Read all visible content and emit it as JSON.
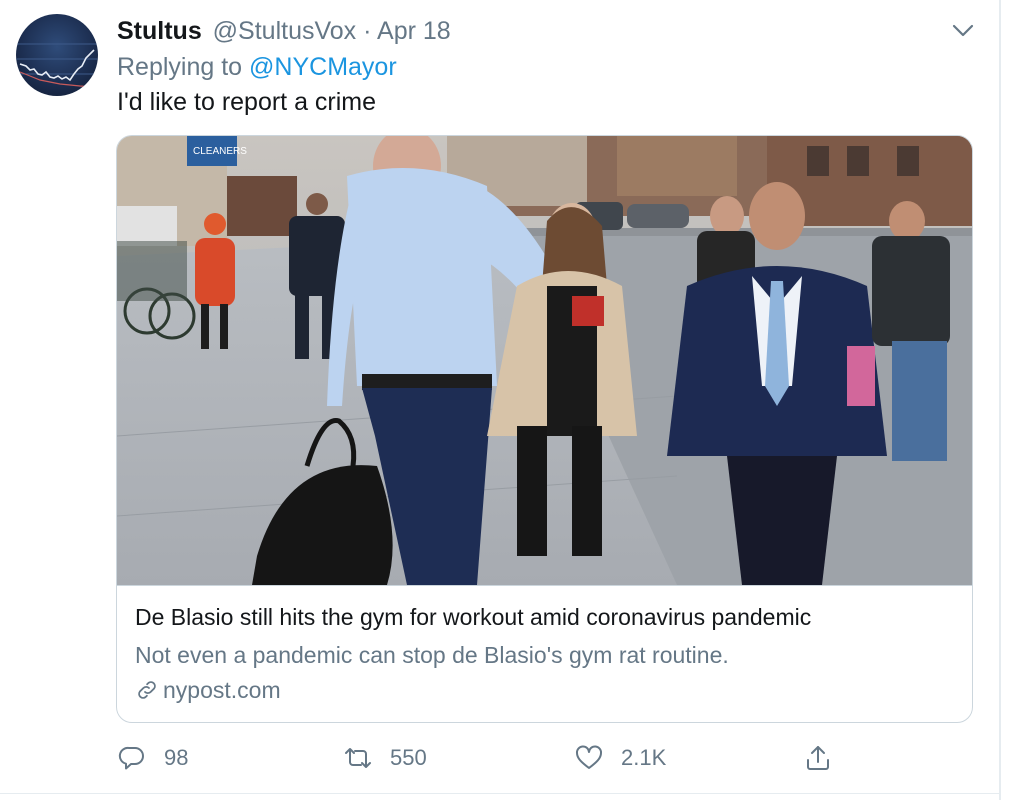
{
  "tweet": {
    "display_name": "Stultus",
    "handle": "@StultusVox",
    "separator": "·",
    "date": "Apr 18",
    "reply_prefix": "Replying to",
    "reply_to": "@NYCMayor",
    "text": "I'd like to report a crime"
  },
  "card": {
    "title": "De Blasio still hits the gym for workout amid coronavirus pandemic",
    "description": "Not even a pandemic can stop de Blasio's gym rat routine.",
    "domain": "nypost.com",
    "storefront_sign": "CLEANERS"
  },
  "actions": {
    "replies": "98",
    "retweets": "550",
    "likes": "2.1K"
  },
  "icons": {
    "caret": "chevron-down-icon",
    "link": "link-icon",
    "reply": "reply-icon",
    "retweet": "retweet-icon",
    "like": "heart-icon",
    "share": "share-icon"
  },
  "colors": {
    "text_primary": "#14171a",
    "text_secondary": "#657786",
    "link": "#1b95e0",
    "border": "#ccd6dd"
  }
}
